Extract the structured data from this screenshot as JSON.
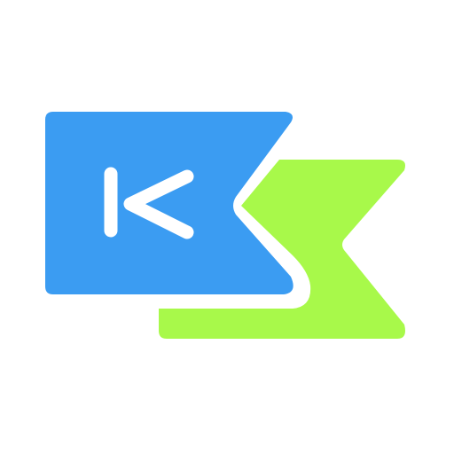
{
  "logo": {
    "icon_name": "k-chevron-logo-icon",
    "colors": {
      "blue": "#3B9CF2",
      "green": "#A8F94A",
      "mark": "#FFFFFF",
      "background": "#FFFFFF"
    }
  }
}
